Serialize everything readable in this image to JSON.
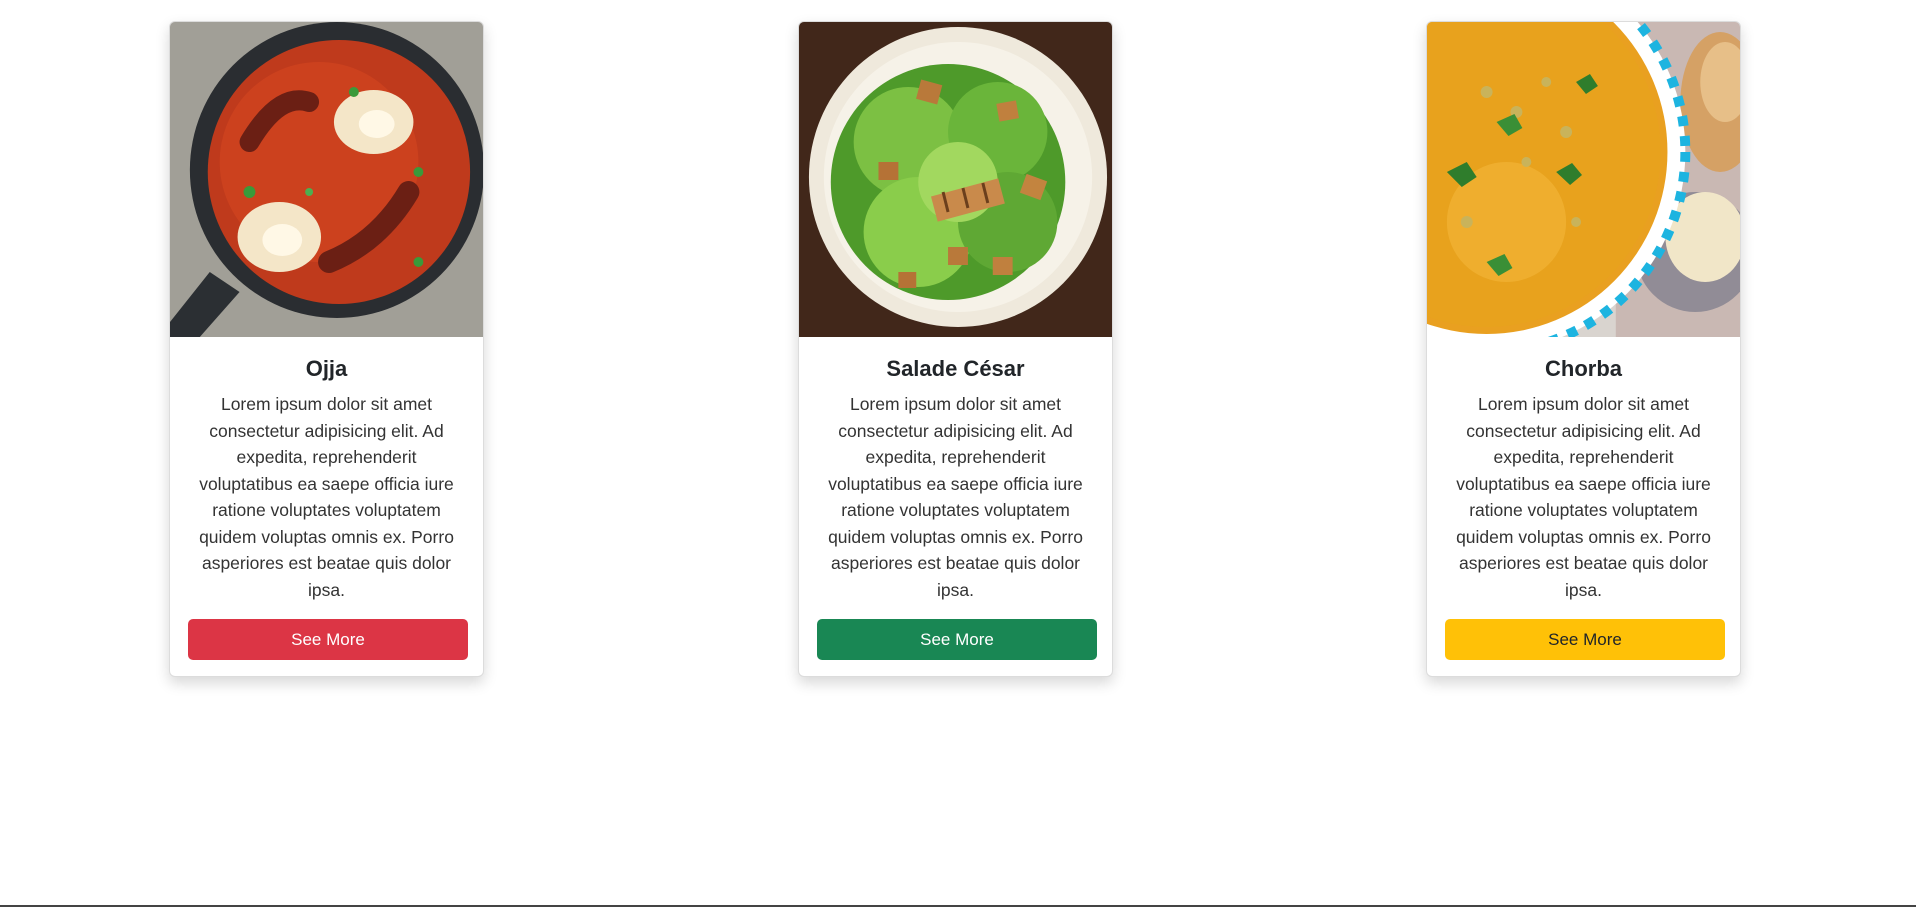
{
  "cards": [
    {
      "title": "Ojja",
      "text": "Lorem ipsum dolor sit amet consectetur adipisicing elit. Ad expedita, reprehenderit voluptatibus ea saepe officia iure ratione voluptates voluptatem quidem voluptas omnis ex. Porro asperiores est beatae quis dolor ipsa.",
      "button_label": "See More",
      "button_color": "#dc3545",
      "image_icon": "ojja-pan-photo"
    },
    {
      "title": "Salade César",
      "text": "Lorem ipsum dolor sit amet consectetur adipisicing elit. Ad expedita, reprehenderit voluptatibus ea saepe officia iure ratione voluptates voluptatem quidem voluptas omnis ex. Porro asperiores est beatae quis dolor ipsa.",
      "button_label": "See More",
      "button_color": "#198754",
      "image_icon": "caesar-salad-photo"
    },
    {
      "title": "Chorba",
      "text": "Lorem ipsum dolor sit amet consectetur adipisicing elit. Ad expedita, reprehenderit voluptatibus ea saepe officia iure ratione voluptates voluptatem quidem voluptas omnis ex. Porro asperiores est beatae quis dolor ipsa.",
      "button_label": "See More",
      "button_color": "#ffc107",
      "image_icon": "chorba-soup-photo"
    }
  ]
}
